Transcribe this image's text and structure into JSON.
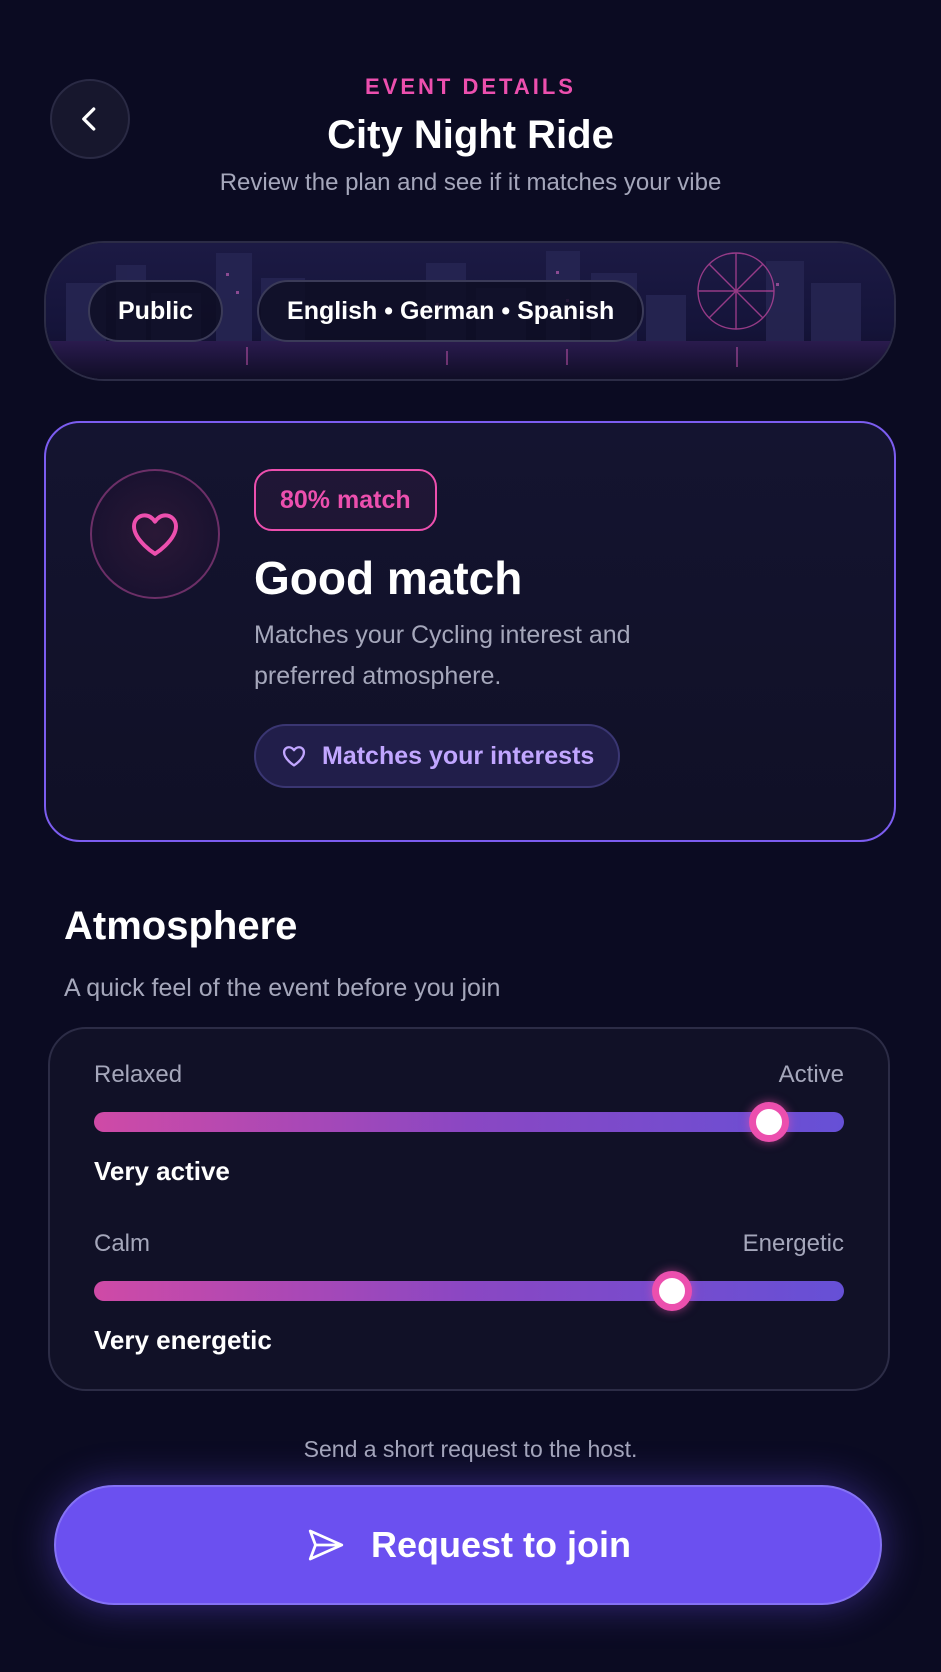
{
  "header": {
    "eyebrow": "EVENT DETAILS",
    "title": "City Night Ride",
    "subtitle": "Review the plan and see if it matches your vibe",
    "back_icon": "chevron-left-icon"
  },
  "banner": {
    "chips": [
      "Public",
      "English • German • Spanish"
    ]
  },
  "match": {
    "icon": "heart-icon",
    "badge": "80% match",
    "title": "Good match",
    "description": "Matches your Cycling interest and preferred atmosphere.",
    "interest_pill": "Matches your interests",
    "accent": "#ec4fae",
    "border_color": "#7c5df0"
  },
  "atmosphere": {
    "title": "Atmosphere",
    "subtitle": "A quick feel of the event before you join",
    "sliders": [
      {
        "left_label": "Relaxed",
        "right_label": "Active",
        "value": 0.9,
        "value_label": "Very active"
      },
      {
        "left_label": "Calm",
        "right_label": "Energetic",
        "value": 0.77,
        "value_label": "Very energetic"
      }
    ]
  },
  "footer": {
    "hint": "Send a short request to the host.",
    "button_label": "Request to join",
    "button_icon": "send-icon",
    "button_color": "#6b50f0"
  }
}
